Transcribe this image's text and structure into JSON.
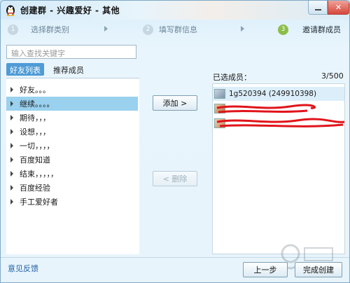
{
  "window": {
    "title": "创建群 - 兴趣爱好 - 其他"
  },
  "steps": [
    {
      "num": "1",
      "label": "选择群类别"
    },
    {
      "num": "2",
      "label": "填写群信息"
    },
    {
      "num": "3",
      "label": "邀请群成员"
    }
  ],
  "search": {
    "placeholder": "输入查找关键字"
  },
  "tabs": {
    "friends": "好友列表",
    "recommended": "推荐成员"
  },
  "groups": [
    {
      "label": "好友。。。"
    },
    {
      "label": "继续。。。。"
    },
    {
      "label": "期待，，，"
    },
    {
      "label": "设想，，，"
    },
    {
      "label": "一切，，，，"
    },
    {
      "label": "百度知道"
    },
    {
      "label": "结束，，，，，"
    },
    {
      "label": "百度经验"
    },
    {
      "label": "手工爱好者"
    }
  ],
  "buttons": {
    "add": "添加 >",
    "remove": "< 删除",
    "prev": "上一步",
    "finish": "完成创建"
  },
  "selected": {
    "label": "已选成员：",
    "count": "3/500",
    "members": [
      {
        "name": "1g520394 (249910398)"
      }
    ]
  },
  "footer": {
    "feedback": "意见反馈"
  },
  "colors": {
    "accent": "#4e9bd6",
    "selected_row": "#99d1ee",
    "step_active": "#8cbe4a",
    "redaction": "#e0141a"
  }
}
